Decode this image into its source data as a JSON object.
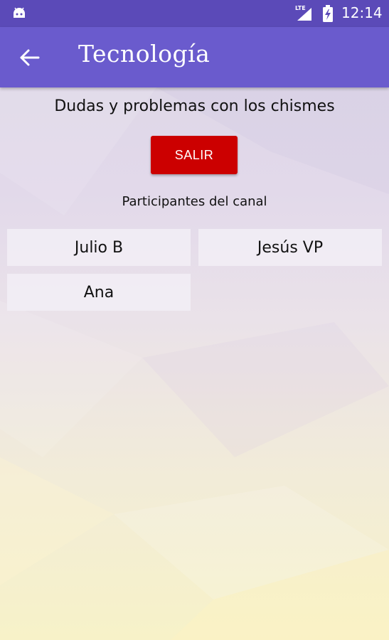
{
  "status_bar": {
    "time": "12:14",
    "network_label": "LTE",
    "notification_icon": "android-icon",
    "battery_icon": "battery-charging-icon"
  },
  "app_bar": {
    "title": "Tecnología",
    "back_icon": "arrow-back-icon",
    "color": "#6a5bcd"
  },
  "channel": {
    "description": "Dudas y problemas con los chismes",
    "exit_label": "SALIR",
    "exit_color": "#cc0000",
    "participants_heading": "Participantes del canal",
    "participants": [
      "Julio B",
      "Jesús VP",
      "Ana"
    ]
  }
}
